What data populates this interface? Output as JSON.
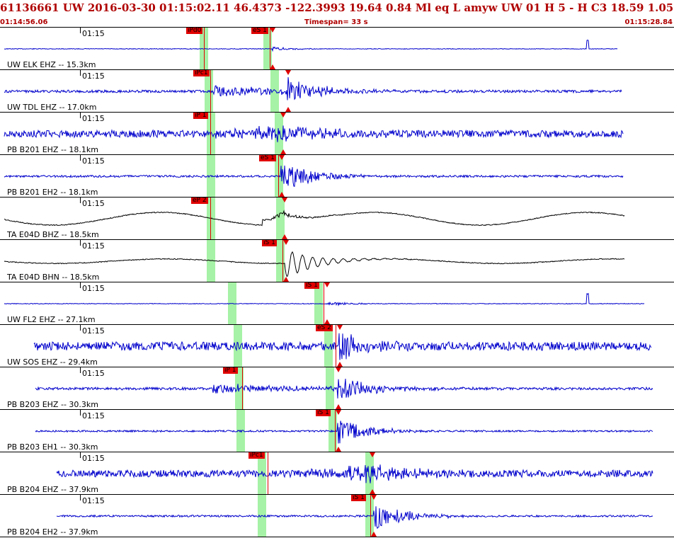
{
  "header": {
    "title": "61136661 UW 2016-03-30 01:15:02.11   46.4373 -122.3993  19.64  0.84 Ml  eq  L amyw     UW 01  H   5  -  H C3   18.59  1.05",
    "start_time": "01:14:56.06",
    "timespan": "Timespan=  33 s",
    "end_time": "01:15:28.84"
  },
  "colors": {
    "trace_blue": "#0000cc",
    "trace_black": "#000000",
    "pick_red": "#e00000",
    "band_green": "#a6f2a6",
    "header_red": "#b00000"
  },
  "tick_label": "01:15",
  "panels": [
    {
      "label": "UW ELK EHZ -- 15.3km",
      "color": "blue",
      "amp": 0.5,
      "picks": [
        {
          "text": "iPd0"
        },
        {
          "text": "eS 1"
        }
      ]
    },
    {
      "label": "UW TDL EHZ -- 17.0km",
      "color": "blue",
      "amp": 0.9,
      "picks": [
        {
          "text": "iPc1"
        }
      ]
    },
    {
      "label": "PB B201 EHZ -- 18.1km",
      "color": "blue",
      "amp": 1.0,
      "picks": [
        {
          "text": "iP 1"
        }
      ]
    },
    {
      "label": "PB B201 EH2 -- 18.1km",
      "color": "blue",
      "amp": 1.0,
      "picks": [
        {
          "text": "eS 1"
        }
      ]
    },
    {
      "label": "TA E04D BHZ -- 18.5km",
      "color": "black",
      "amp": 0.9,
      "picks": [
        {
          "text": "eP 2"
        }
      ]
    },
    {
      "label": "TA E04D BHN -- 18.5km",
      "color": "black",
      "amp": 0.8,
      "picks": [
        {
          "text": "iS 1"
        }
      ]
    },
    {
      "label": "UW FL2 EHZ -- 27.1km",
      "color": "blue",
      "amp": 0.5,
      "picks": [
        {
          "text": "iS 1"
        }
      ]
    },
    {
      "label": "UW SOS EHZ -- 29.4km",
      "color": "blue",
      "amp": 1.0,
      "picks": [
        {
          "text": "eS 2"
        }
      ]
    },
    {
      "label": "PB B203 EHZ -- 30.3km",
      "color": "blue",
      "amp": 0.9,
      "picks": [
        {
          "text": "iP 1"
        }
      ]
    },
    {
      "label": "PB B203 EH1 -- 30.3km",
      "color": "blue",
      "amp": 0.8,
      "picks": [
        {
          "text": "iS 1"
        }
      ]
    },
    {
      "label": "PB B204 EHZ -- 37.9km",
      "color": "blue",
      "amp": 1.0,
      "picks": [
        {
          "text": "iPc1"
        }
      ]
    },
    {
      "label": "PB B204 EH2 -- 37.9km",
      "color": "blue",
      "amp": 0.9,
      "picks": [
        {
          "text": "iS 1"
        }
      ]
    }
  ]
}
